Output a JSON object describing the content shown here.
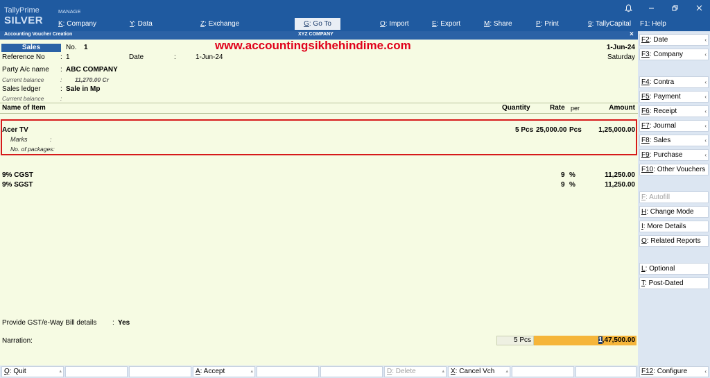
{
  "header": {
    "brand_top": "TallyPrime",
    "brand_edition": "SILVER",
    "section": "MANAGE",
    "menu": [
      {
        "key": "K",
        "label": ": Company"
      },
      {
        "key": "Y",
        "label": ": Data"
      },
      {
        "key": "Z",
        "label": ": Exchange"
      },
      {
        "key": "G",
        "label": ": Go To"
      },
      {
        "key": "O",
        "label": ": Import"
      },
      {
        "key": "E",
        "label": ": Export"
      },
      {
        "key": "M",
        "label": ": Share"
      },
      {
        "key": "P",
        "label": ": Print"
      },
      {
        "key": "9",
        "label": ": TallyCapital"
      }
    ],
    "help": "F1: Help",
    "bell_icon": "bell-icon"
  },
  "titlebar": {
    "left": "Accounting Voucher Creation",
    "center": "XYZ COMPANY",
    "close": "×"
  },
  "watermark": "www.accountingsikhehindime.com",
  "voucher": {
    "type": "Sales",
    "no_label": "No.",
    "no": "1",
    "date_right": "1-Jun-24",
    "day": "Saturday",
    "ref_label": "Reference No",
    "ref_value": "1",
    "date_label": "Date",
    "date_value": "1-Jun-24",
    "party_label": "Party A/c name",
    "party_value": "ABC COMPANY",
    "cur_bal_label": "Current balance",
    "cur_bal_value": "11,270.00 Cr",
    "ledger_label": "Sales ledger",
    "ledger_value": "Sale in Mp",
    "cur_bal2_label": "Current balance"
  },
  "table": {
    "headers": {
      "item": "Name of Item",
      "qty": "Quantity",
      "rate": "Rate",
      "per": "per",
      "amount": "Amount"
    },
    "item": {
      "name": "Acer TV",
      "qty": "5 Pcs",
      "rate": "25,000.00",
      "per": "Pcs",
      "amount": "1,25,000.00",
      "marks_label": "Marks",
      "packages_label": "No. of packages:"
    },
    "taxes": [
      {
        "name": "9% CGST",
        "rate": "9",
        "unit": "%",
        "amount": "11,250.00"
      },
      {
        "name": "9% SGST",
        "rate": "9",
        "unit": "%",
        "amount": "11,250.00"
      }
    ]
  },
  "footer": {
    "gst_label": "Provide GST/e-Way Bill details",
    "gst_value": "Yes",
    "narration_label": "Narration:",
    "total_qty": "5 Pcs",
    "total_amount_first": "1",
    "total_amount_rest": ",47,500.00"
  },
  "right_panel": [
    {
      "key": "F2",
      "label": ": Date"
    },
    {
      "key": "F3",
      "label": ": Company"
    },
    {
      "key": "F4",
      "label": ": Contra"
    },
    {
      "key": "F5",
      "label": ": Payment"
    },
    {
      "key": "F6",
      "label": ": Receipt"
    },
    {
      "key": "F7",
      "label": ": Journal"
    },
    {
      "key": "F8",
      "label": ": Sales"
    },
    {
      "key": "F9",
      "label": ": Purchase"
    },
    {
      "key": "F10",
      "label": ": Other Vouchers"
    },
    {
      "key": "F",
      "label": ": Autofill"
    },
    {
      "key": "H",
      "label": ": Change Mode"
    },
    {
      "key": "I",
      "label": ": More Details"
    },
    {
      "key": "O",
      "label": ": Related Reports"
    },
    {
      "key": "L",
      "label": ": Optional"
    },
    {
      "key": "T",
      "label": ": Post-Dated"
    }
  ],
  "bottom_bar": [
    {
      "key": "Q",
      "label": ": Quit"
    },
    {
      "key": "A",
      "label": ": Accept"
    },
    {
      "key": "D",
      "label": ": Delete"
    },
    {
      "key": "X",
      "label": ": Cancel Vch"
    }
  ],
  "f12": {
    "key": "F12",
    "label": ": Configure"
  }
}
